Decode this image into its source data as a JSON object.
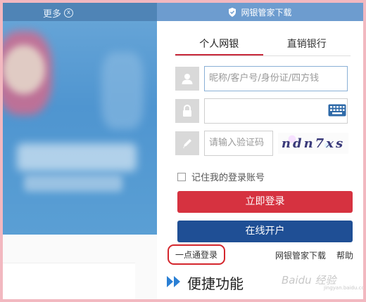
{
  "banner": {
    "more_label": "更多",
    "close_glyph": "x"
  },
  "panel": {
    "download_header": "网银管家下载",
    "tabs": [
      {
        "label": "个人网银",
        "active": true
      },
      {
        "label": "直销银行",
        "active": false
      }
    ],
    "username_placeholder": "昵称/客户号/身份证/四方钱",
    "password_placeholder": "",
    "captcha_placeholder": "请输入验证码",
    "captcha_text": "ndn7xs",
    "remember_label": "记住我的登录账号",
    "login_button": "立即登录",
    "open_account_button": "在线开户"
  },
  "links": {
    "quick_login": "一点通登录",
    "download": "网银管家下载",
    "help": "帮助"
  },
  "shortcut": {
    "label": "便捷功能"
  },
  "watermark": {
    "text": "Baidu 经验",
    "sub": "jingyan.baidu.com"
  },
  "colors": {
    "login_button": "#d63240",
    "open_button": "#1f4f95",
    "tab_active_underline": "#c8283a",
    "header_bar": "#6d9ccf",
    "quick_login_highlight": "#d4262d",
    "page_border": "#f2b8c0"
  },
  "icons": {
    "header": "shield-icon",
    "username": "user-icon",
    "password": "lock-icon",
    "captcha": "pencil-icon",
    "keyboard": "keyboard-icon",
    "shortcut": "double-chevron-right-icon"
  }
}
